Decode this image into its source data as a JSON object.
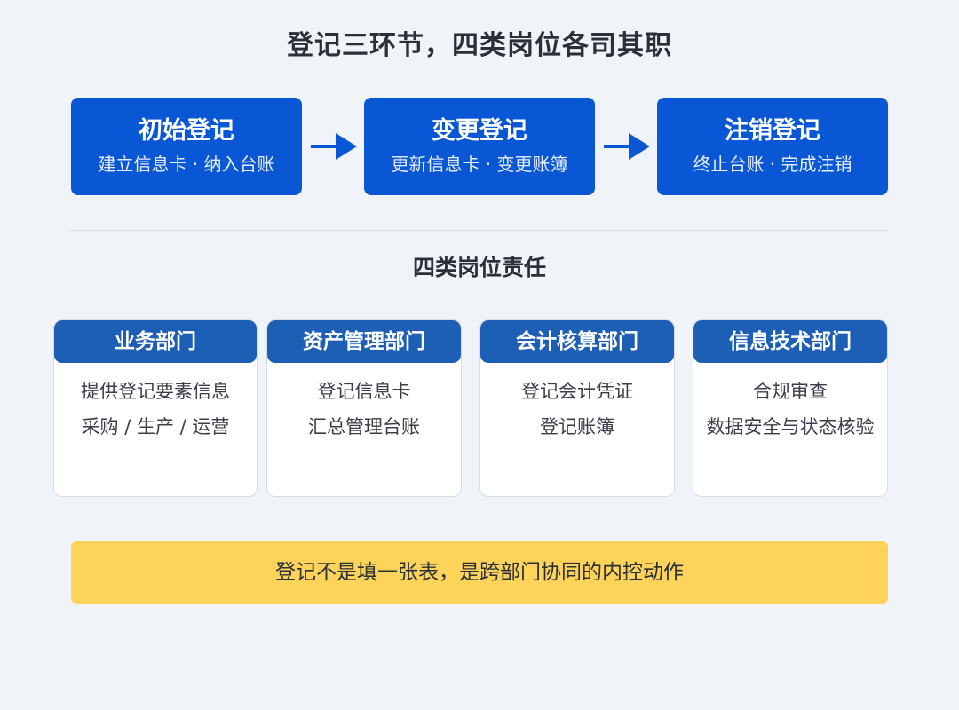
{
  "title": "登记三环节，四类岗位各司其职",
  "stages": [
    {
      "name": "初始登记",
      "desc": "建立信息卡 · 纳入台账"
    },
    {
      "name": "变更登记",
      "desc": "更新信息卡 · 变更账簿"
    },
    {
      "name": "注销登记",
      "desc": "终止台账 · 完成注销"
    }
  ],
  "subtitle": "四类岗位责任",
  "roles": [
    {
      "name": "业务部门",
      "lines": [
        "提供登记要素信息",
        "采购 / 生产 / 运营"
      ]
    },
    {
      "name": "资产管理部门",
      "lines": [
        "登记信息卡",
        "汇总管理台账"
      ]
    },
    {
      "name": "会计核算部门",
      "lines": [
        "登记会计凭证",
        "登记账簿"
      ]
    },
    {
      "name": "信息技术部门",
      "lines": [
        "合规审查",
        "数据安全与状态核验"
      ]
    }
  ],
  "callout": "登记不是填一张表，是跨部门协同的内控动作",
  "colors": {
    "stage": "#0a57d6",
    "role_header": "#1d5fb4",
    "callout": "#fdd35a",
    "background": "#f0f4f9"
  }
}
